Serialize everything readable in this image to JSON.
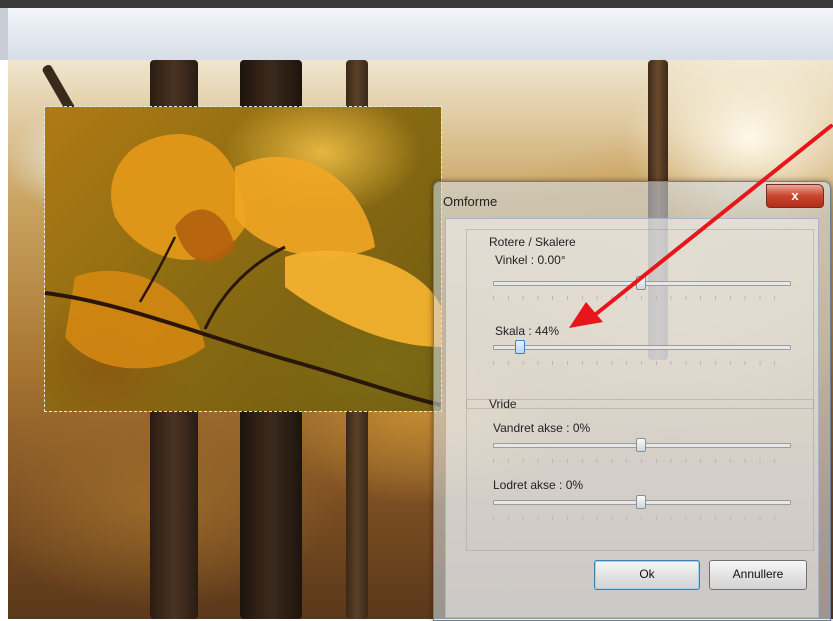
{
  "dialog": {
    "title": "Omforme",
    "close_label": "x",
    "rotate_scale": {
      "title": "Rotere / Skalere",
      "angle_label": "Vinkel : 0.00°",
      "angle_value": 0.5,
      "scale_label": "Skala : 44%",
      "scale_value": 0.09
    },
    "skew": {
      "title": "Vride",
      "horizontal_label": "Vandret akse : 0%",
      "horizontal_value": 0.5,
      "vertical_label": "Lodret akse : 0%",
      "vertical_value": 0.5
    },
    "ok_label": "Ok",
    "cancel_label": "Annullere"
  },
  "annotation": {
    "arrow_color": "#e8161b"
  }
}
